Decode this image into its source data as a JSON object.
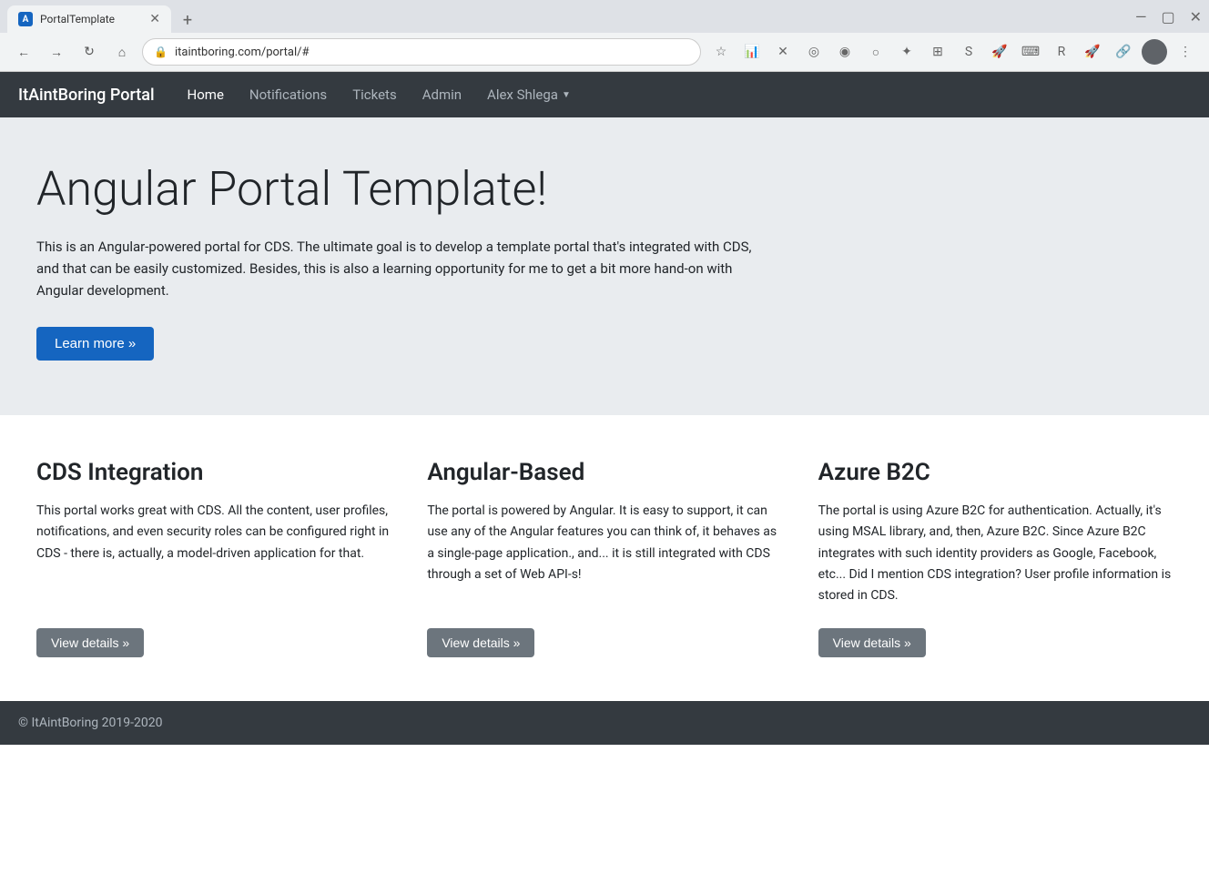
{
  "browser": {
    "tab_title": "PortalTemplate",
    "url": "itaintboring.com/portal/#",
    "new_tab_label": "+",
    "back_label": "←",
    "forward_label": "→",
    "refresh_label": "↻",
    "home_label": "⌂",
    "lock_icon": "🔒",
    "star_icon": "☆",
    "menu_icon": "⋮",
    "profile_initial": ""
  },
  "navbar": {
    "brand": "ItAintBoring Portal",
    "links": [
      {
        "label": "Home",
        "active": true
      },
      {
        "label": "Notifications",
        "active": false
      },
      {
        "label": "Tickets",
        "active": false
      },
      {
        "label": "Admin",
        "active": false
      }
    ],
    "user": "Alex Shlega"
  },
  "hero": {
    "title": "Angular Portal Template!",
    "description": "This is an Angular-powered portal for CDS. The ultimate goal is to develop a template portal that's integrated with CDS, and that can be easily customized. Besides, this is also a learning opportunity for me to get a bit more hand-on with Angular development.",
    "cta_label": "Learn more »"
  },
  "features": [
    {
      "title": "CDS Integration",
      "description": "This portal works great with CDS. All the content, user profiles, notifications, and even security roles can be configured right in CDS - there is, actually, a model-driven application for that.",
      "btn_label": "View details »"
    },
    {
      "title": "Angular-Based",
      "description": "The portal is powered by Angular. It is easy to support, it can use any of the Angular features you can think of, it behaves as a single-page application., and... it is still integrated with CDS through a set of Web API-s!",
      "btn_label": "View details »"
    },
    {
      "title": "Azure B2C",
      "description": "The portal is using Azure B2C for authentication. Actually, it's using MSAL library, and, then, Azure B2C. Since Azure B2C integrates with such identity providers as Google, Facebook, etc... Did I mention CDS integration? User profile information is stored in CDS.",
      "btn_label": "View details »"
    }
  ],
  "footer": {
    "copyright": "© ItAintBoring 2019-2020"
  }
}
